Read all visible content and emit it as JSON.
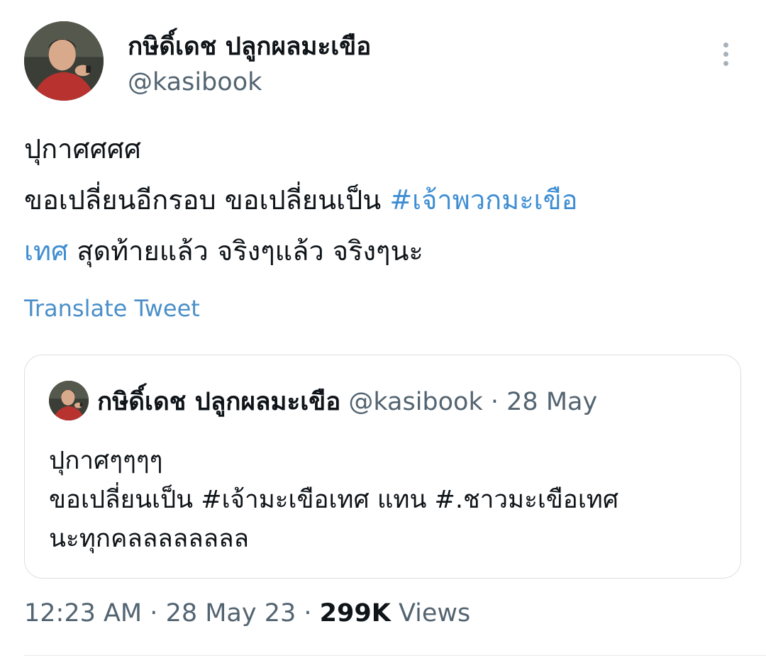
{
  "tweet": {
    "author": {
      "display_name": "กษิดิ์เดช ปลูกผลมะเขือ",
      "handle": "@kasibook",
      "avatar_icon": "profile-photo"
    },
    "more_icon": "more-vertical-icon",
    "lines": [
      [
        {
          "text": "ปุกาศศศศ",
          "hashtag": false
        }
      ],
      [
        {
          "text": "ขอเปลี่ยนอีกรอบ ขอเปลี่ยนเป็น ",
          "hashtag": false
        },
        {
          "text": "#เจ้าพวกมะเขือ",
          "hashtag": true
        }
      ],
      [
        {
          "text": "เทศ",
          "hashtag": true
        },
        {
          "text": " สุดท้ายแล้ว จริงๆแล้ว จริงๆนะ",
          "hashtag": false
        }
      ]
    ],
    "translate_label": "Translate Tweet",
    "quoted": {
      "display_name": "กษิดิ์เดช ปลูกผลมะเขือ",
      "handle": "@kasibook",
      "separator": "·",
      "date": "28 May",
      "lines": [
        "ปุกาศๆๆๆๆ",
        "ขอเปลี่ยนเป็น #เจ้ามะเขือเทศ แทน #.ชาวมะเขือเทศ",
        "นะทุกคลลลลลลลล"
      ]
    },
    "meta": {
      "time": "12:23 AM",
      "separator": "·",
      "date": "28 May 23",
      "views_count": "299K",
      "views_label": "Views"
    }
  },
  "colors": {
    "text": "#0f1419",
    "secondary": "#536471",
    "link": "#3f8ed3",
    "border": "#dcdfe3"
  }
}
